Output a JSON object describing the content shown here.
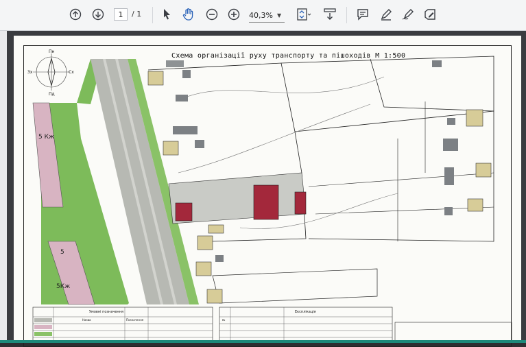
{
  "toolbar": {
    "page_current": "1",
    "page_total": "/ 1",
    "zoom_value": "40,3%",
    "icons": [
      "page-up-icon",
      "page-down-icon",
      "select-cursor-icon",
      "hand-tool-icon",
      "zoom-out-icon",
      "zoom-in-icon",
      "fit-page-icon",
      "scroll-mode-icon",
      "comment-icon",
      "highlight-pen-icon",
      "sign-icon",
      "fill-sign-icon"
    ]
  },
  "document": {
    "title": "Схема організації руху транспорту та пішоходів М 1:500",
    "compass_top": "Пн",
    "compass_bottom": "Пд",
    "compass_left": "Зх",
    "compass_right": "Сх",
    "building_label_1": "5 Кж",
    "building_label_2": "5",
    "building_label_3": "5Кж",
    "legend_header": "Умовні позначення",
    "explication_header": "Експлікація",
    "legend_col_name": "Назва",
    "legend_col_symbol": "Позначення",
    "explication_col_no": "№"
  },
  "colors": {
    "toolbar_bg": "#f4f5f6",
    "sheet_bg": "#fbfbf8",
    "green_zone": "#7dbb5a",
    "road_gray": "#b7b9b3",
    "building_red": "#a3283b",
    "building_pink": "#d8b4c2",
    "building_tan": "#d7cc98",
    "accent_teal": "#1d8a7a"
  }
}
